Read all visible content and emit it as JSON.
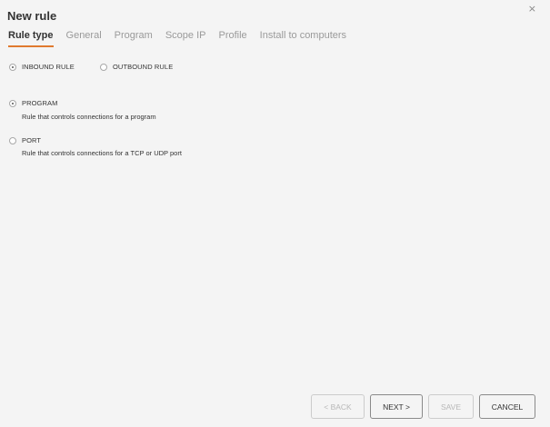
{
  "window": {
    "title": "New rule",
    "close_glyph": "×"
  },
  "tabs": [
    {
      "label": "Rule type",
      "active": true
    },
    {
      "label": "General"
    },
    {
      "label": "Program"
    },
    {
      "label": "Scope IP"
    },
    {
      "label": "Profile"
    },
    {
      "label": "Install to computers"
    }
  ],
  "direction": {
    "inbound": {
      "label": "INBOUND RULE",
      "selected": true
    },
    "outbound": {
      "label": "OUTBOUND RULE",
      "selected": false
    }
  },
  "rule_kind": {
    "program": {
      "label": "PROGRAM",
      "description": "Rule that controls connections for a program",
      "selected": true
    },
    "port": {
      "label": "PORT",
      "description": "Rule that controls connections for a TCP or UDP port",
      "selected": false
    }
  },
  "buttons": {
    "back": "< BACK",
    "next": "NEXT >",
    "save": "SAVE",
    "cancel": "CANCEL"
  },
  "colors": {
    "accent": "#e07a2f",
    "background": "#f4f4f4"
  }
}
